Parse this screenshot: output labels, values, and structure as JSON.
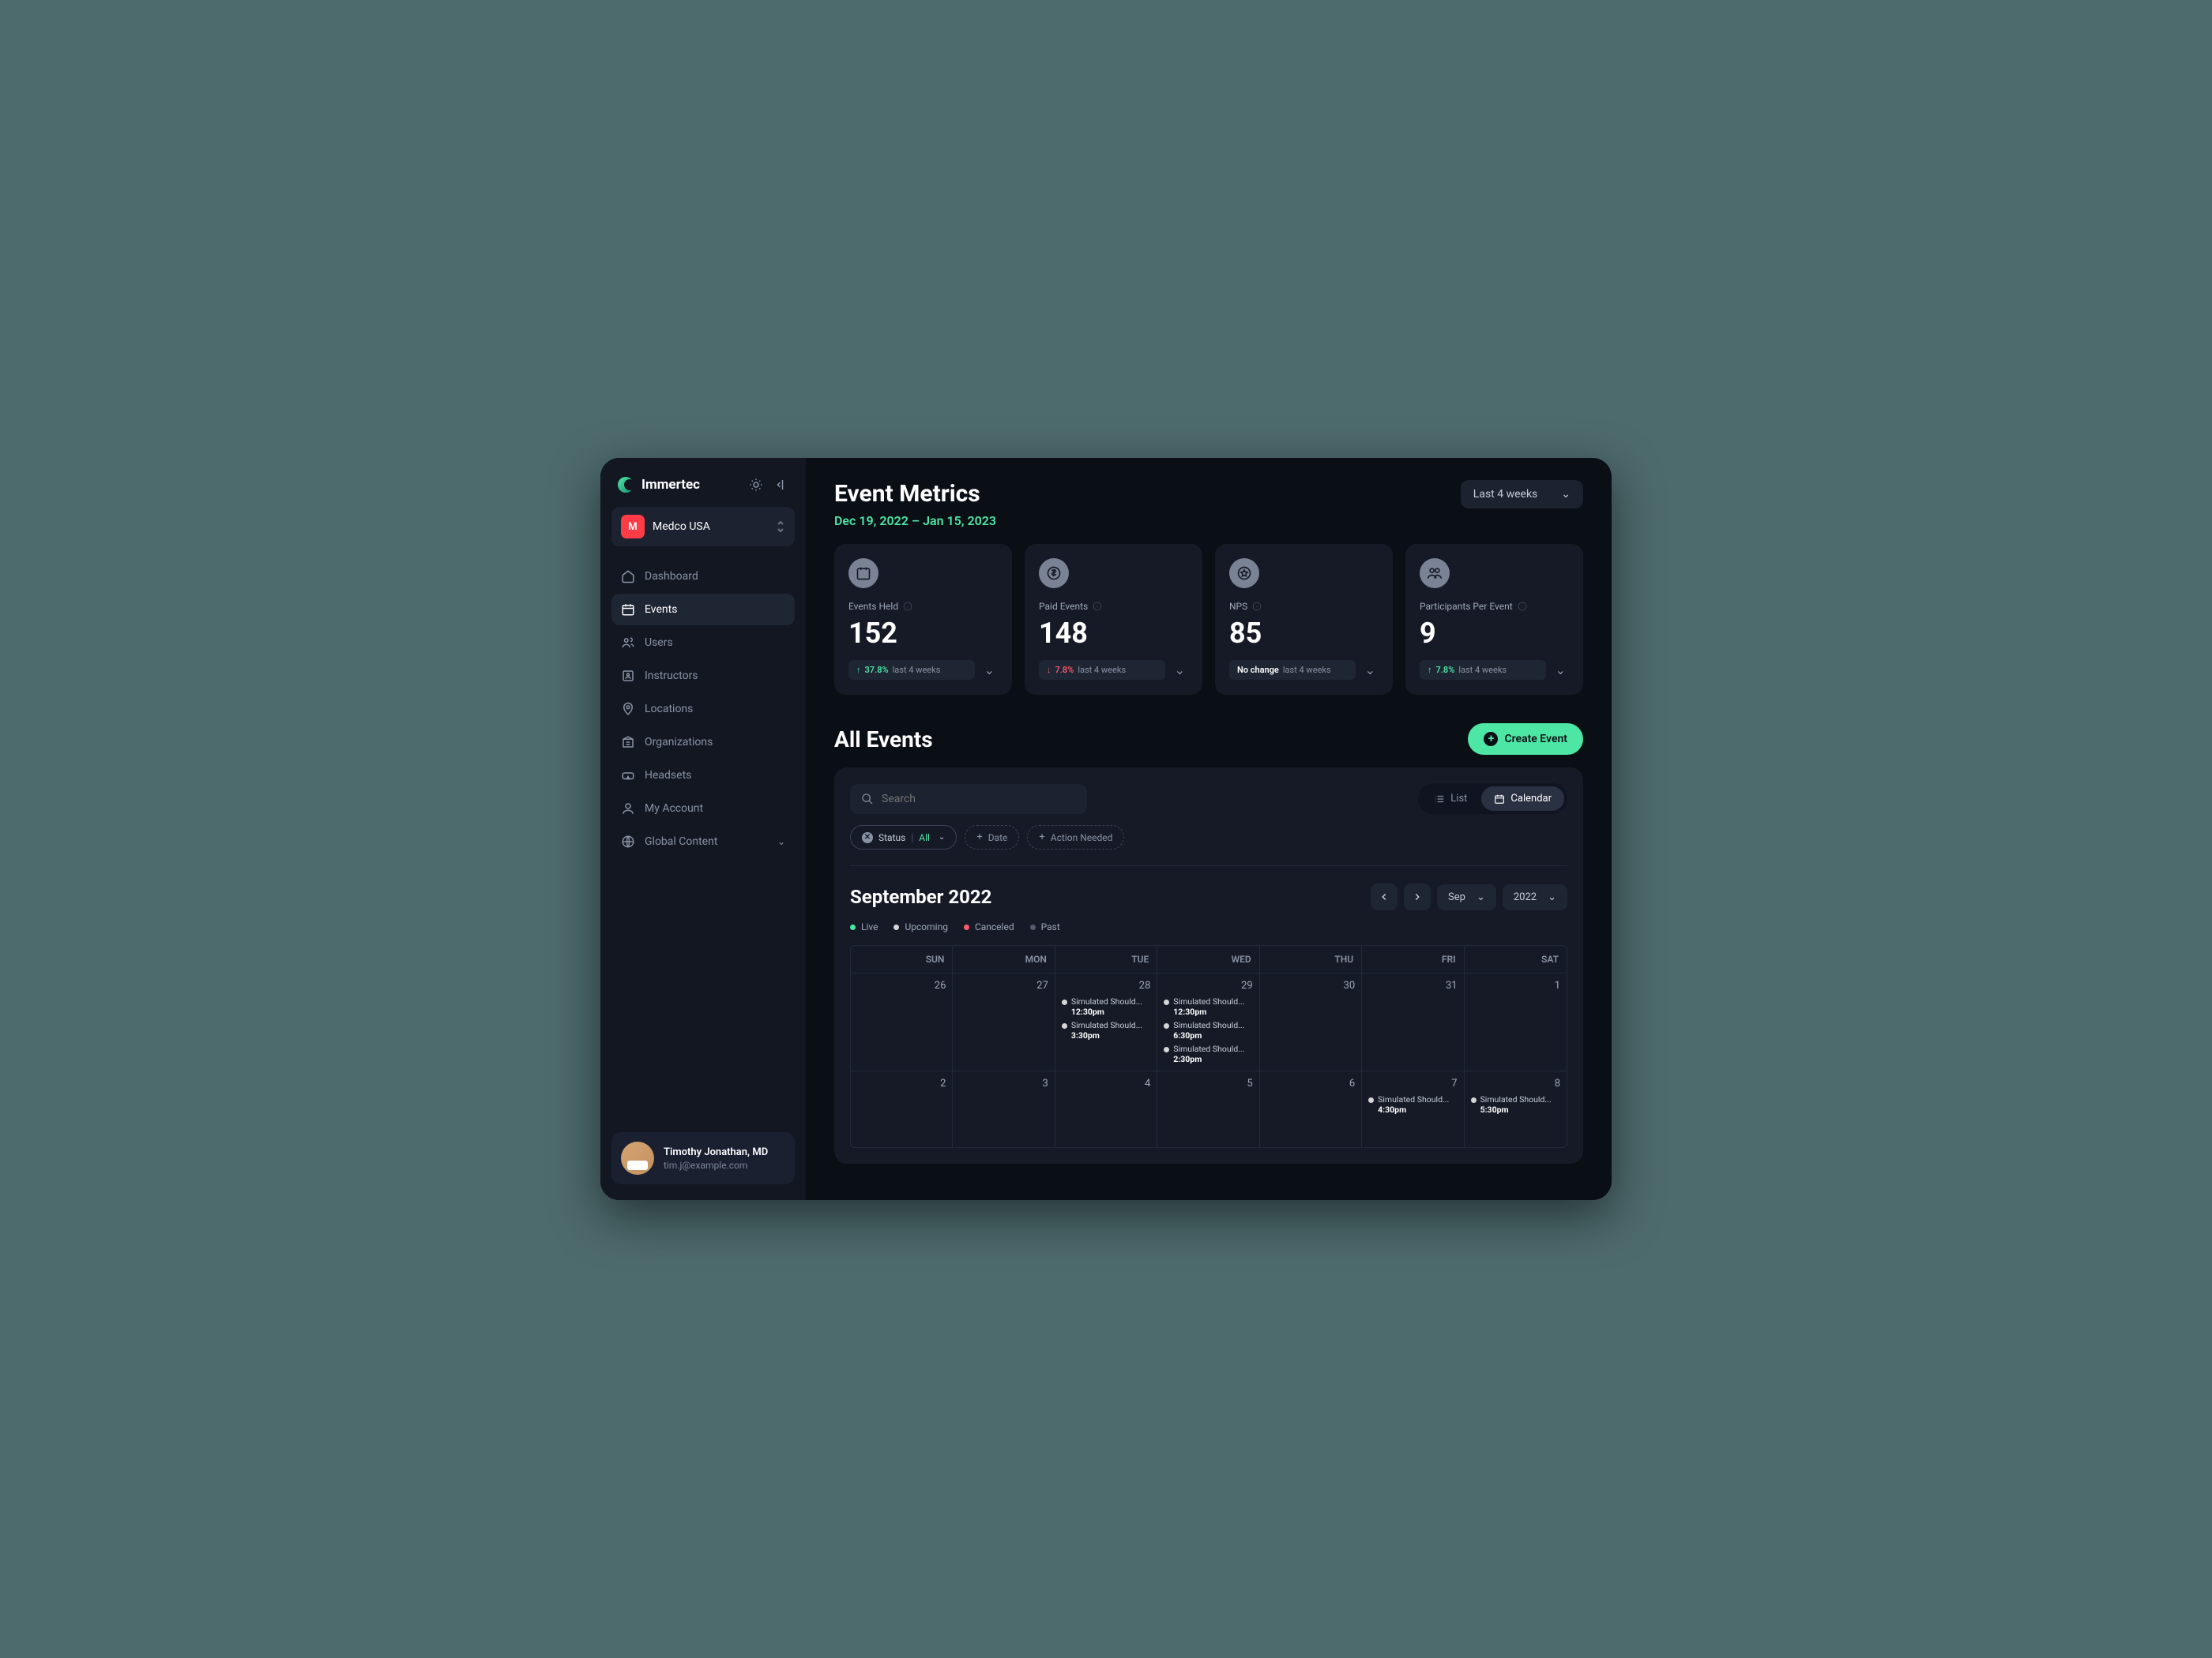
{
  "brand": "Immertec",
  "org": {
    "name": "Medco USA",
    "initial": "M"
  },
  "nav": [
    {
      "label": "Dashboard"
    },
    {
      "label": "Events"
    },
    {
      "label": "Users"
    },
    {
      "label": "Instructors"
    },
    {
      "label": "Locations"
    },
    {
      "label": "Organizations"
    },
    {
      "label": "Headsets"
    },
    {
      "label": "My Account"
    },
    {
      "label": "Global Content"
    }
  ],
  "user": {
    "name": "Timothy Jonathan, MD",
    "email": "tim.j@example.com"
  },
  "metrics": {
    "title": "Event Metrics",
    "range_label": "Dec 19, 2022 – Jan 15, 2023",
    "range_select": "Last 4 weeks",
    "cards": [
      {
        "label": "Events Held",
        "value": "152",
        "trend": "up",
        "pct": "37.8%",
        "period": "last 4 weeks"
      },
      {
        "label": "Paid Events",
        "value": "148",
        "trend": "down",
        "pct": "7.8%",
        "period": "last 4 weeks"
      },
      {
        "label": "NPS",
        "value": "85",
        "trend": "none",
        "pct": "No change",
        "period": "last 4 weeks"
      },
      {
        "label": "Participants Per Event",
        "value": "9",
        "trend": "up",
        "pct": "7.8%",
        "period": "last 4 weeks"
      }
    ]
  },
  "events": {
    "title": "All Events",
    "create_label": "Create Event",
    "search_placeholder": "Search",
    "views": {
      "list": "List",
      "calendar": "Calendar"
    },
    "filters": {
      "status_label": "Status",
      "status_value": "All",
      "date_label": "Date",
      "action_label": "Action Needed"
    },
    "calendar": {
      "title": "September 2022",
      "month": "Sep",
      "year": "2022",
      "legend": {
        "live": "Live",
        "upcoming": "Upcoming",
        "canceled": "Canceled",
        "past": "Past"
      },
      "days": [
        "SUN",
        "MON",
        "TUE",
        "WED",
        "THU",
        "FRI",
        "SAT"
      ],
      "weeks": [
        [
          {
            "date": "26",
            "events": []
          },
          {
            "date": "27",
            "events": []
          },
          {
            "date": "28",
            "events": [
              {
                "status": "upcoming",
                "title": "Simulated Should...",
                "time": "12:30pm"
              },
              {
                "status": "upcoming",
                "title": "Simulated Should...",
                "time": "3:30pm"
              }
            ]
          },
          {
            "date": "29",
            "events": [
              {
                "status": "upcoming",
                "title": "Simulated Should...",
                "time": "12:30pm"
              },
              {
                "status": "upcoming",
                "title": "Simulated Should...",
                "time": "6:30pm"
              },
              {
                "status": "upcoming",
                "title": "Simulated Should...",
                "time": "2:30pm"
              }
            ]
          },
          {
            "date": "30",
            "events": []
          },
          {
            "date": "31",
            "events": []
          },
          {
            "date": "1",
            "events": []
          }
        ],
        [
          {
            "date": "2",
            "events": []
          },
          {
            "date": "3",
            "events": []
          },
          {
            "date": "4",
            "events": []
          },
          {
            "date": "5",
            "events": []
          },
          {
            "date": "6",
            "events": []
          },
          {
            "date": "7",
            "events": [
              {
                "status": "upcoming",
                "title": "Simulated Should...",
                "time": "4:30pm"
              }
            ]
          },
          {
            "date": "8",
            "events": [
              {
                "status": "upcoming",
                "title": "Simulated Should...",
                "time": "5:30pm"
              }
            ]
          }
        ]
      ]
    }
  }
}
